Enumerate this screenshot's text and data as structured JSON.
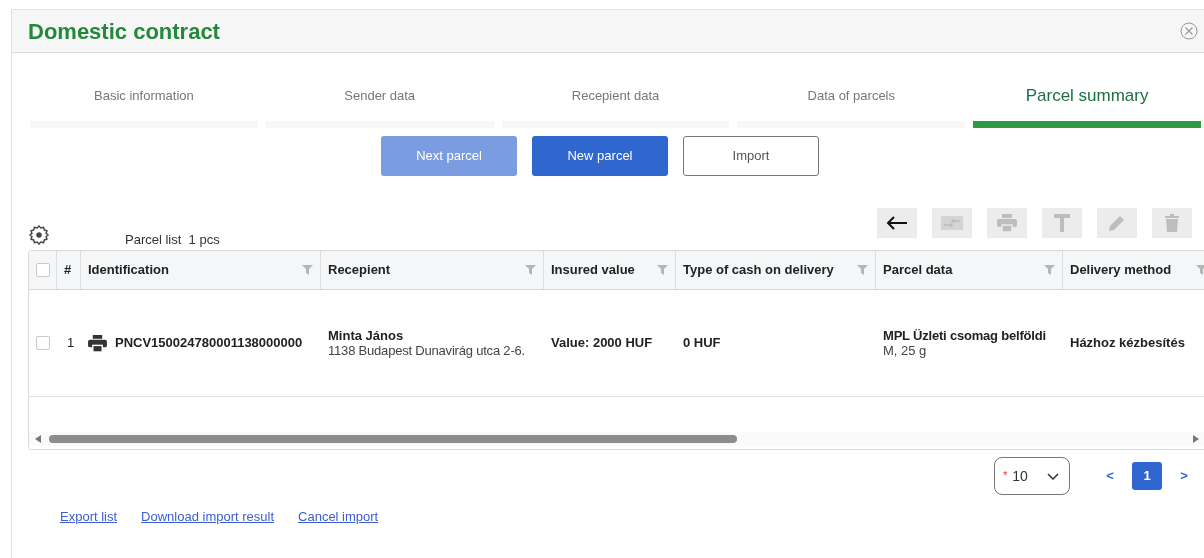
{
  "window": {
    "title": "Domestic contract"
  },
  "tabs": [
    {
      "label": "Basic information",
      "selected": false
    },
    {
      "label": "Sender data",
      "selected": false
    },
    {
      "label": "Recepient data",
      "selected": false
    },
    {
      "label": "Data of parcels",
      "selected": false
    },
    {
      "label": "Parcel summary",
      "selected": true
    }
  ],
  "actions": [
    {
      "label": "Next parcel",
      "kind": "primary",
      "disabled": true
    },
    {
      "label": "New parcel",
      "kind": "primary",
      "disabled": false
    },
    {
      "label": "Import",
      "kind": "outline"
    }
  ],
  "list": {
    "title": "Parcel list",
    "count": "1 pcs"
  },
  "toolbar": [
    {
      "kind": "back",
      "disabled": false
    },
    {
      "kind": "swap",
      "disabled": true
    },
    {
      "kind": "print",
      "disabled": true
    },
    {
      "kind": "text",
      "disabled": true
    },
    {
      "kind": "edit",
      "disabled": true
    },
    {
      "kind": "delete",
      "disabled": true
    }
  ],
  "table": {
    "header_checked": false,
    "columns": [
      {
        "label": "#",
        "kind": "plain"
      },
      {
        "label": "Identification",
        "kind": "filterable"
      },
      {
        "label": "Recepient",
        "kind": "filterable"
      },
      {
        "label": "Insured value",
        "kind": "filterable"
      },
      {
        "label": "Type of cash on delivery",
        "kind": "filterable"
      },
      {
        "label": "Parcel data",
        "kind": "filterable"
      },
      {
        "label": "Delivery method",
        "kind": "filterable"
      }
    ],
    "rows": [
      {
        "checked": false,
        "number": "1",
        "identification": "PNCV150024780001138000000",
        "recepient_name": "Minta János",
        "recepient_address": "1138 Budapest Dunavirág utca 2-6.",
        "insured_value": "Value: 2000 HUF",
        "cash_on_delivery": "0 HUF",
        "parcel_type": "MPL Üzleti csomag belföldi",
        "parcel_detail": "M, 25 g",
        "delivery_method": "Házhoz kézbesítés"
      }
    ]
  },
  "pagination": {
    "page_size": "10",
    "required_mark": "*",
    "prev": "<",
    "next": ">",
    "pages": [
      {
        "label": "1",
        "selected": true
      }
    ]
  },
  "links": [
    "Export list",
    "Download import result",
    "Cancel import"
  ]
}
